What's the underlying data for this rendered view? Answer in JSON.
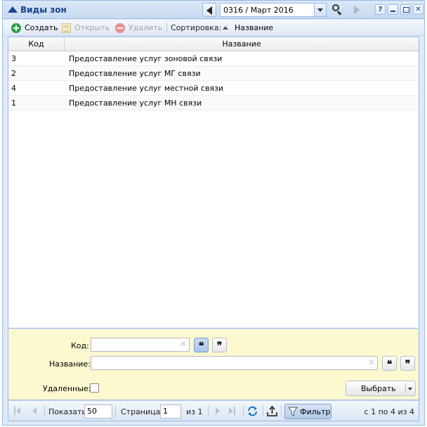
{
  "window": {
    "title": "Виды зон",
    "period": "0316 / Март 2016",
    "tools": {
      "help": "?",
      "close": "✕"
    }
  },
  "toolbar": {
    "create_label": "Создать",
    "open_label": "Открыть",
    "delete_label": "Удалить",
    "sort_label": "Сортировка:",
    "sort_field": "Название"
  },
  "grid": {
    "columns": {
      "code": "Код",
      "name": "Название"
    },
    "rows": [
      {
        "code": "3",
        "name": "Предоставление услуг зоновой связи"
      },
      {
        "code": "2",
        "name": "Предоставление услуг МГ связи"
      },
      {
        "code": "4",
        "name": "Предоставление услуг местной связи"
      },
      {
        "code": "1",
        "name": "Предоставление услуг МН связи"
      }
    ]
  },
  "filter": {
    "code_label": "Код:",
    "code_value": "",
    "name_label": "Название:",
    "name_value": "",
    "clear_glyph": "✕",
    "quote_open": "❝",
    "quote_close": "❞",
    "deleted_label": "Удаленные:",
    "deleted_checked": false,
    "select_label": "Выбрать"
  },
  "pager": {
    "show_label": "Показать",
    "limit": "50",
    "page_label": "Страница",
    "page": "1",
    "of_label": "из 1",
    "filter_label": "Фильтр",
    "range_text": "с 1 по 4 из 4"
  },
  "icons": {
    "accent_blue": "#15428b",
    "create_green": "#2aa142",
    "refresh_blue": "#1a73c8"
  }
}
